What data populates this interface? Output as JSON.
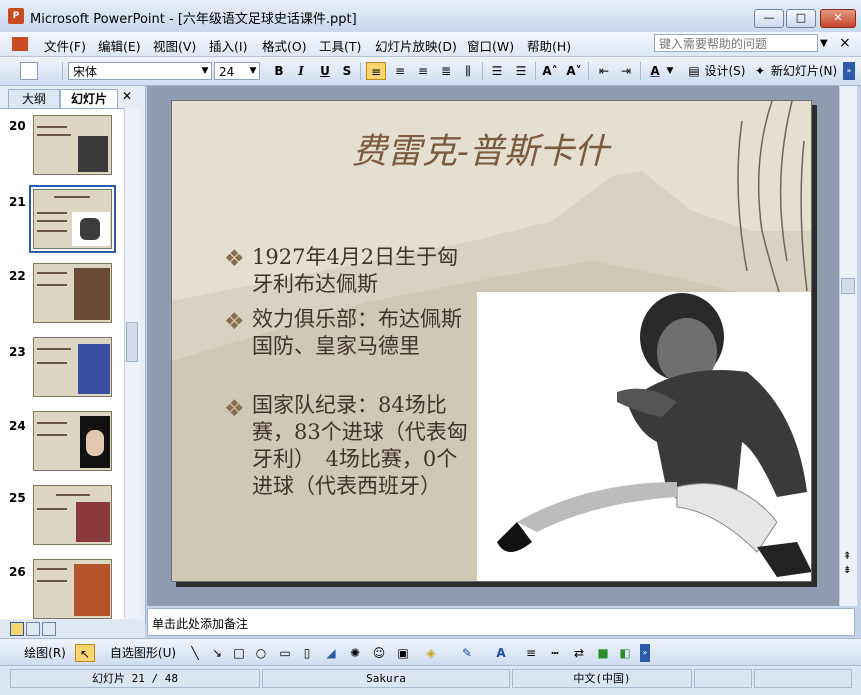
{
  "window": {
    "title": "Microsoft PowerPoint - [六年级语文足球史话课件.ppt]",
    "app_icon_text": "P",
    "minimize": "—",
    "maximize": "□",
    "close": "✕"
  },
  "menu": {
    "items": [
      "文件(F)",
      "编辑(E)",
      "视图(V)",
      "插入(I)",
      "格式(O)",
      "工具(T)",
      "幻灯片放映(D)",
      "窗口(W)",
      "帮助(H)"
    ],
    "help_placeholder": "键入需要帮助的问题",
    "close_doc": "×"
  },
  "toolbar": {
    "font_name": "宋体",
    "font_size": "24",
    "bold": "B",
    "italic": "I",
    "underline": "U",
    "shadow": "S",
    "font_color": "A",
    "design": "设计(S)",
    "new_slide": "新幻灯片(N)"
  },
  "left_pane": {
    "tabs": [
      "大纲",
      "幻灯片"
    ],
    "active_tab": "幻灯片",
    "close": "✕",
    "slides": [
      {
        "num": "20",
        "selected": false
      },
      {
        "num": "21",
        "selected": true
      },
      {
        "num": "22",
        "selected": false
      },
      {
        "num": "23",
        "selected": false
      },
      {
        "num": "24",
        "selected": false
      },
      {
        "num": "25",
        "selected": false
      },
      {
        "num": "26",
        "selected": false
      }
    ]
  },
  "slide": {
    "title": "费雷克-普斯卡什",
    "bullet_glyph": "❖",
    "bullets": [
      "1927年4月2日生于匈牙利布达佩斯",
      "效力俱乐部：布达佩斯国防、皇家马德里",
      "国家队纪录：84场比赛，83个进球（代表匈牙利）　4场比赛，0个进球（代表西班牙）"
    ]
  },
  "notes": {
    "placeholder": "单击此处添加备注"
  },
  "draw_toolbar": {
    "draw": "绘图(R)",
    "autoshapes": "自选图形(U)"
  },
  "status": {
    "slide_info": "幻灯片 21 / 48",
    "design": "Sakura",
    "language": "中文(中国)"
  },
  "colors": {
    "title_bar": "#c7d7ee",
    "slide_bg": "#e2ddcd",
    "title_color": "#7b5a3e",
    "selection": "#2b5aa8"
  }
}
